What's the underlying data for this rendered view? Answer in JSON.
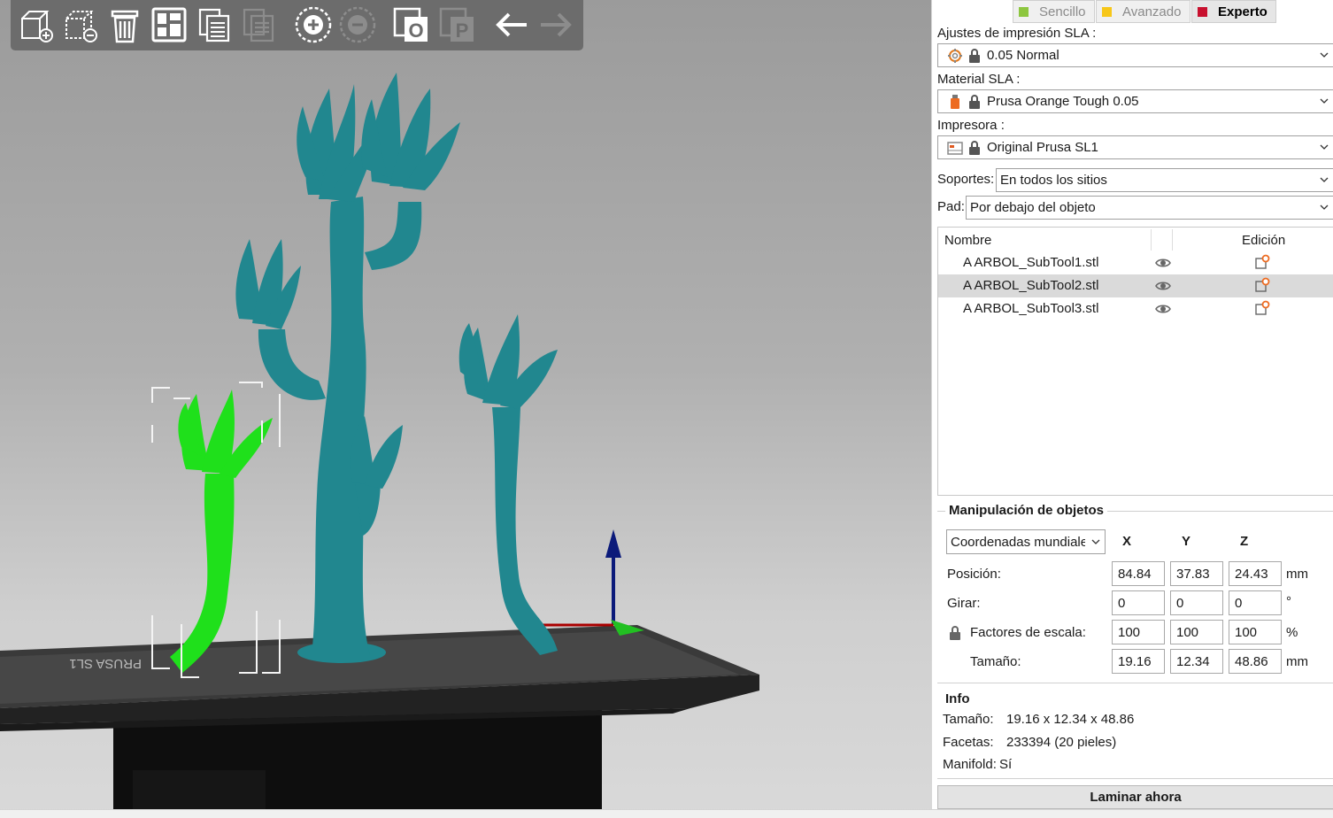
{
  "toolbar": {
    "buttons": [
      {
        "name": "add-icon",
        "enabled": true
      },
      {
        "name": "delete-icon",
        "enabled": true
      },
      {
        "name": "delete-all-icon",
        "enabled": true
      },
      {
        "name": "arrange-icon",
        "enabled": true
      },
      {
        "name": "copy-icon",
        "enabled": true
      },
      {
        "name": "paste-icon",
        "enabled": false
      },
      {
        "name": "add-instance-icon",
        "enabled": true
      },
      {
        "name": "remove-instance-icon",
        "enabled": false
      },
      {
        "name": "split-objects-icon",
        "enabled": true
      },
      {
        "name": "split-parts-icon",
        "enabled": false
      },
      {
        "name": "undo-icon",
        "enabled": true
      },
      {
        "name": "redo-icon",
        "enabled": false
      }
    ]
  },
  "modes": [
    {
      "label": "Sencillo",
      "color": "#8dc63f",
      "active": false
    },
    {
      "label": "Avanzado",
      "color": "#f7c719",
      "active": false
    },
    {
      "label": "Experto",
      "color": "#c8102e",
      "active": true
    }
  ],
  "print_settings": {
    "label": "Ajustes de impresión SLA :",
    "value": "0.05 Normal",
    "icon": "gear-icon"
  },
  "material": {
    "label": "Material SLA :",
    "value": "Prusa Orange Tough 0.05",
    "icon": "resin-bottle-icon",
    "color": "#ed6b21"
  },
  "printer": {
    "label": "Impresora :",
    "value": "Original Prusa SL1",
    "icon": "printer-icon"
  },
  "supports": {
    "label": "Soportes:",
    "value": "En todos los sitios"
  },
  "pad": {
    "label": "Pad:",
    "value": "Por debajo del objeto"
  },
  "object_list": {
    "col_name": "Nombre",
    "col_edit": "Edición",
    "rows": [
      {
        "name": "A ARBOL_SubTool1.stl",
        "selected": false
      },
      {
        "name": "A ARBOL_SubTool2.stl",
        "selected": true
      },
      {
        "name": "A ARBOL_SubTool3.stl",
        "selected": false
      }
    ]
  },
  "manipulation": {
    "title": "Manipulación de objetos",
    "coord_system": "Coordenadas mundiales",
    "axes": [
      "X",
      "Y",
      "Z"
    ],
    "position": {
      "label": "Posición:",
      "values": [
        "84.84",
        "37.83",
        "24.43"
      ],
      "unit": "mm"
    },
    "rotate": {
      "label": "Girar:",
      "values": [
        "0",
        "0",
        "0"
      ],
      "unit": "°"
    },
    "scale": {
      "label": "Factores de escala:",
      "values": [
        "100",
        "100",
        "100"
      ],
      "unit": "%"
    },
    "size": {
      "label": "Tamaño:",
      "values": [
        "19.16",
        "12.34",
        "48.86"
      ],
      "unit": "mm"
    }
  },
  "info": {
    "title": "Info",
    "size_label": "Tamaño:",
    "size_value": "19.16 x 12.34 x 48.86",
    "facets_label": "Facetas:",
    "facets_value": "233394 (20 pieles)",
    "manifold_label": "Manifold:",
    "manifold_value": "Sí"
  },
  "slice_button": "Laminar ahora",
  "colors": {
    "selected_object": "#1fe01b",
    "object": "#21878f",
    "bed": "#2a2a2a",
    "toolbar": "#6c6c6c"
  }
}
